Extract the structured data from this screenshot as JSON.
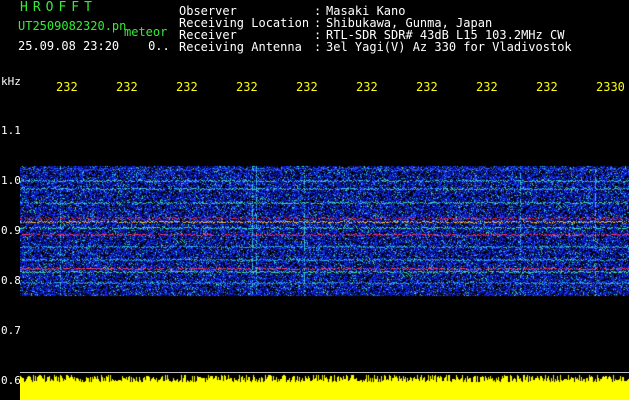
{
  "header": {
    "brand": "HROFFT",
    "filename": "UT2509082320.pn",
    "mode": "meteor",
    "datetime": "25.09.08 23:20",
    "mark": "0.."
  },
  "info": {
    "labels": "Observer\nReceiving Location\nReceiver\nReceiving Antenna",
    "colons": ":\n:\n:\n:",
    "values": "Masaki Kano\nShibukawa, Gunma, Japan\nRTL-SDR SDR# 43dB L15 103.2MHz CW\n3el Yagi(V) Az 330 for Vladivostok"
  },
  "axis": {
    "unit": "kHz",
    "time_ticks": [
      "232",
      "232",
      "232",
      "232",
      "232",
      "232",
      "232",
      "232",
      "232",
      "2330"
    ],
    "freq_ticks": [
      "1.1",
      "1.0",
      "0.9",
      "0.8",
      "0.7",
      "0.6"
    ]
  },
  "colors": {
    "background": "#000000",
    "header_green": "#33ee33",
    "tick_yellow": "#ffff00",
    "level_yellow": "#ffff00",
    "band_red": "#ff2040",
    "noise_blue": "#1028ff",
    "noise_cyan": "#30d0e0"
  }
}
